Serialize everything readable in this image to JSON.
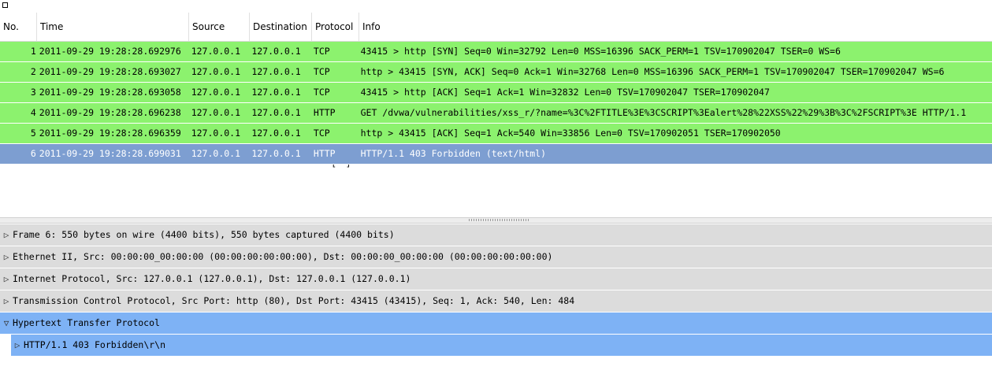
{
  "columns": {
    "no": "No.",
    "time": "Time",
    "source": "Source",
    "destination": "Destination",
    "protocol": "Protocol",
    "info": "Info"
  },
  "packets": [
    {
      "no": "1",
      "time": "2011-09-29 19:28:28.692976",
      "source": "127.0.0.1",
      "destination": "127.0.0.1",
      "protocol": "TCP",
      "info": "43415 > http [SYN] Seq=0 Win=32792 Len=0 MSS=16396 SACK_PERM=1 TSV=170902047 TSER=0 WS=6"
    },
    {
      "no": "2",
      "time": "2011-09-29 19:28:28.693027",
      "source": "127.0.0.1",
      "destination": "127.0.0.1",
      "protocol": "TCP",
      "info": "http > 43415 [SYN, ACK] Seq=0 Ack=1 Win=32768 Len=0 MSS=16396 SACK_PERM=1 TSV=170902047 TSER=170902047 WS=6"
    },
    {
      "no": "3",
      "time": "2011-09-29 19:28:28.693058",
      "source": "127.0.0.1",
      "destination": "127.0.0.1",
      "protocol": "TCP",
      "info": "43415 > http [ACK] Seq=1 Ack=1 Win=32832 Len=0 TSV=170902047 TSER=170902047"
    },
    {
      "no": "4",
      "time": "2011-09-29 19:28:28.696238",
      "source": "127.0.0.1",
      "destination": "127.0.0.1",
      "protocol": "HTTP",
      "info": "GET /dvwa/vulnerabilities/xss_r/?name=%3C%2FTITLE%3E%3CSCRIPT%3Ealert%28%22XSS%22%29%3B%3C%2FSCRIPT%3E HTTP/1.1"
    },
    {
      "no": "5",
      "time": "2011-09-29 19:28:28.696359",
      "source": "127.0.0.1",
      "destination": "127.0.0.1",
      "protocol": "TCP",
      "info": "http > 43415 [ACK] Seq=1 Ack=540 Win=33856 Len=0 TSV=170902051 TSER=170902050"
    },
    {
      "no": "6",
      "time": "2011-09-29 19:28:28.699031",
      "source": "127.0.0.1",
      "destination": "127.0.0.1",
      "protocol": "HTTP",
      "info": "HTTP/1.1 403 Forbidden  (text/html)"
    }
  ],
  "partial_row_text": "[  ]",
  "details": {
    "frame": "Frame 6: 550 bytes on wire (4400 bits), 550 bytes captured (4400 bits)",
    "ethernet": "Ethernet II, Src: 00:00:00_00:00:00 (00:00:00:00:00:00), Dst: 00:00:00_00:00:00 (00:00:00:00:00:00)",
    "ip": "Internet Protocol, Src: 127.0.0.1 (127.0.0.1), Dst: 127.0.0.1 (127.0.0.1)",
    "tcp": "Transmission Control Protocol, Src Port: http (80), Dst Port: 43415 (43415), Seq: 1, Ack: 540, Len: 484",
    "http": "Hypertext Transfer Protocol",
    "http_status": "HTTP/1.1 403 Forbidden\\r\\n"
  },
  "icons": {
    "collapsed": "▷",
    "expanded": "▽"
  },
  "colors": {
    "tcp_row": "#8cf26e",
    "selected_row": "#7d9ed1",
    "detail_highlight": "#7eb2f5",
    "detail_row": "#dcdcdc"
  }
}
